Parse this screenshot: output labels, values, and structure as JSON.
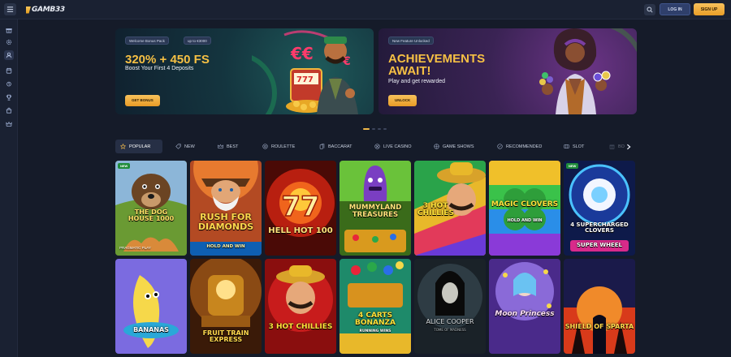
{
  "header": {
    "logo_text": "GAMB33",
    "login_label": "LOG IN",
    "signup_label": "SIGN UP"
  },
  "rail": {
    "items": [
      "gift-icon",
      "gear-cog-icon",
      "user-icon",
      "calendar-icon",
      "trophy-icon",
      "cup-icon",
      "store-icon",
      "crown-icon"
    ]
  },
  "banners": [
    {
      "badge1": "Welcome Bonus Pack",
      "badge2": "up to €3000",
      "title": "320% + 450 FS",
      "subtitle": "Boost Your First 4 Deposits",
      "cta": "GET BONUS"
    },
    {
      "badge1": "New Feature Unlocked",
      "title": "ACHIEVEMENTS AWAIT!",
      "subtitle": "Play and get rewarded",
      "cta": "UNLOCK"
    }
  ],
  "carousel": {
    "active_index": 0,
    "count": 4
  },
  "tabs": [
    {
      "label": "POPULAR",
      "icon": "star-icon",
      "active": true
    },
    {
      "label": "NEW",
      "icon": "tag-icon",
      "active": false
    },
    {
      "label": "BEST",
      "icon": "crown-icon",
      "active": false
    },
    {
      "label": "ROULETTE",
      "icon": "roulette-icon",
      "active": false
    },
    {
      "label": "BACCARAT",
      "icon": "cards-icon",
      "active": false
    },
    {
      "label": "LIVE CASINO",
      "icon": "live-icon",
      "active": false
    },
    {
      "label": "GAME SHOWS",
      "icon": "wheel-icon",
      "active": false
    },
    {
      "label": "RECOMMENDED",
      "icon": "thumb-icon",
      "active": false
    },
    {
      "label": "SLOT",
      "icon": "slot-icon",
      "active": false
    },
    {
      "label": "BO",
      "icon": "bonus-icon",
      "active": false
    }
  ],
  "games": [
    {
      "name": "THE DOG HOUSE 1000",
      "badge": "NEW",
      "provider": "PRAGMATIC PLAY"
    },
    {
      "name": "RUSH FOR DIAMONDS",
      "subtitle": "HOLD AND WIN"
    },
    {
      "name": "HELL HOT 100"
    },
    {
      "name": "MUMMYLAND TREASURES"
    },
    {
      "name": "3 HOT CHILLIES"
    },
    {
      "name": "MAGIC CLOVERS",
      "subtitle": "HOLD AND WIN"
    },
    {
      "name": "4 SUPERCHARGED CLOVERS",
      "subtitle": "SUPER WHEEL",
      "badge": "NEW"
    },
    {
      "name": "BANANAS"
    },
    {
      "name": "FRUIT TRAIN EXPRESS"
    },
    {
      "name": "3 HOT CHILLIES"
    },
    {
      "name": "4 CARTS BONANZA",
      "subtitle": "RUNNING WINS"
    },
    {
      "name": "ALICE COOPER",
      "subtitle": "TOME OF MADNESS"
    },
    {
      "name": "Moon Princess"
    },
    {
      "name": "SHIELD OF SPARTA"
    }
  ]
}
